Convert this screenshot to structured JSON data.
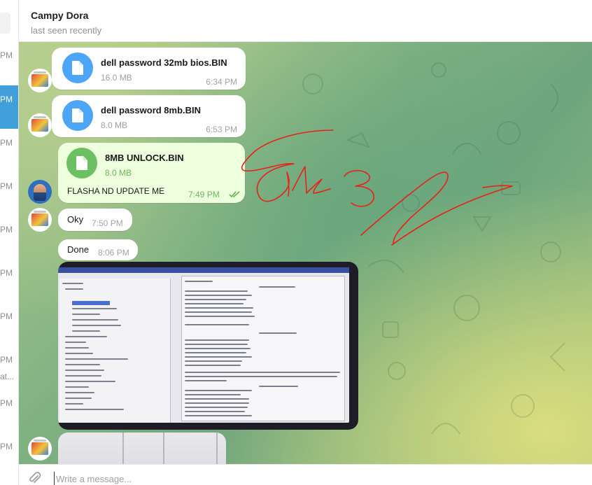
{
  "sidebar": {
    "times": [
      "PM",
      "PM",
      "PM",
      "PM",
      "PM",
      "PM",
      "PM",
      "PM",
      "at...",
      "PM",
      "PM"
    ]
  },
  "header": {
    "title": "Campy Dora",
    "status": "last seen recently"
  },
  "messages": [
    {
      "type": "file",
      "name": "dell password 32mb bios.BIN",
      "size": "16.0 MB",
      "time": "6:34 PM",
      "direction": "in"
    },
    {
      "type": "file",
      "name": "dell password 8mb.BIN",
      "size": "8.0 MB",
      "time": "6:53 PM",
      "direction": "in"
    },
    {
      "type": "file",
      "name": "8MB UNLOCK.BIN",
      "size": "8.0 MB",
      "caption": "FLASHA ND UPDATE ME",
      "time": "7:49 PM",
      "direction": "out",
      "read": true
    },
    {
      "type": "text",
      "text": "Oky",
      "time": "7:50 PM",
      "direction": "in"
    },
    {
      "type": "text",
      "text": "Done",
      "time": "8:06 PM",
      "direction": "in"
    },
    {
      "type": "photo",
      "description_icon": "bios-screenshot-photo",
      "direction": "in"
    },
    {
      "type": "photo",
      "description_icon": "bios-screenshot-photo-partial",
      "direction": "in"
    }
  ],
  "composer": {
    "placeholder": "Write a message..."
  },
  "colors": {
    "accent": "#419fd9",
    "file_icon_in": "#4ea4f6",
    "file_icon_out": "#6cc062",
    "outgoing_bubble": "#eeffde",
    "scribble": "#e8211b"
  }
}
